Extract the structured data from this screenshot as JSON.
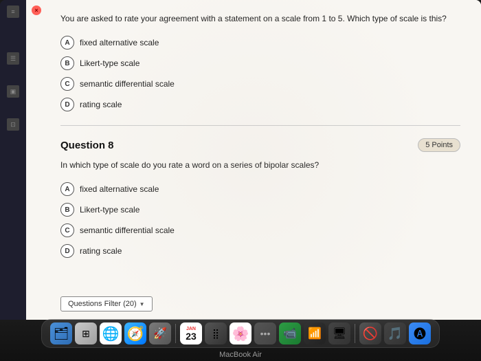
{
  "quiz": {
    "question7": {
      "text": "You are asked to rate your agreement with a statement on a scale from 1 to 5. Which type of scale is this?",
      "options": [
        {
          "letter": "A",
          "label": "fixed alternative scale"
        },
        {
          "letter": "B",
          "label": "Likert-type scale"
        },
        {
          "letter": "C",
          "label": "semantic differential scale"
        },
        {
          "letter": "D",
          "label": "rating scale"
        }
      ]
    },
    "question8": {
      "title": "Question 8",
      "points": "5 Points",
      "text": "In which type of scale do you rate a word on a series of bipolar scales?",
      "options": [
        {
          "letter": "A",
          "label": "fixed alternative scale"
        },
        {
          "letter": "B",
          "label": "Likert-type scale"
        },
        {
          "letter": "C",
          "label": "semantic differential scale"
        },
        {
          "letter": "D",
          "label": "rating scale"
        }
      ]
    },
    "filter_button": "Questions Filter (20)"
  },
  "dock": {
    "items": [
      {
        "name": "Finder",
        "icon": "🗂"
      },
      {
        "name": "Launchpad",
        "icon": "🚀"
      },
      {
        "name": "Chrome",
        "icon": "🌐"
      },
      {
        "name": "Safari",
        "icon": "🧭"
      },
      {
        "name": "Rocket",
        "icon": "🚀"
      },
      {
        "name": "Calendar",
        "icon": "23"
      },
      {
        "name": "Apps",
        "icon": "⠿"
      },
      {
        "name": "Music",
        "icon": "♫"
      },
      {
        "name": "Photos",
        "icon": "🌸"
      },
      {
        "name": "More",
        "icon": "…"
      },
      {
        "name": "FaceTime",
        "icon": "📹"
      },
      {
        "name": "Bars",
        "icon": "📊"
      },
      {
        "name": "VPN",
        "icon": "🖥"
      },
      {
        "name": "NoEntry",
        "icon": "🚫"
      },
      {
        "name": "Music2",
        "icon": "🎵"
      },
      {
        "name": "AppStore",
        "icon": "🅐"
      }
    ],
    "macbook_label": "MacBook Air"
  },
  "window": {
    "close_label": "×"
  }
}
